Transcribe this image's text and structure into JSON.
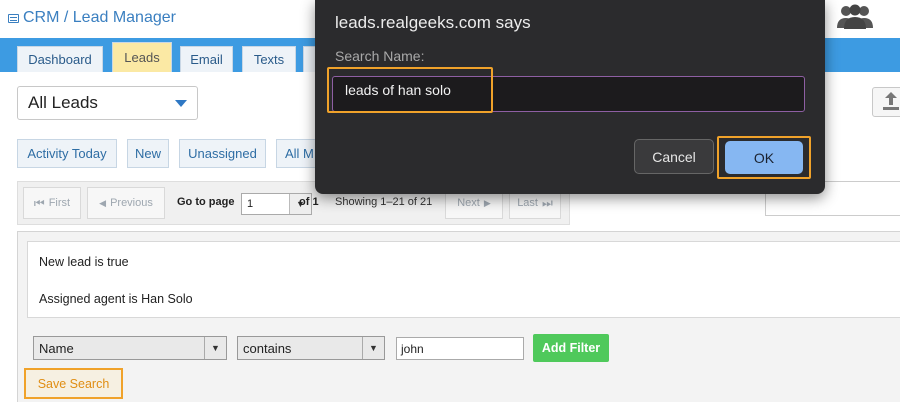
{
  "app": {
    "title": "CRM / Lead Manager",
    "icon": "crm-icon"
  },
  "tabs": [
    {
      "label": "Dashboard",
      "active": false
    },
    {
      "label": "Leads",
      "active": true
    },
    {
      "label": "Email",
      "active": false
    },
    {
      "label": "Texts",
      "active": false
    }
  ],
  "lead_view": {
    "selected": "All Leads"
  },
  "quick_filters": [
    "Activity Today",
    "New",
    "Unassigned",
    "All M"
  ],
  "pager": {
    "first": "First",
    "previous": "Previous",
    "goto_label": "Go to page",
    "page_value": "1",
    "of_label": "of 1",
    "showing": "Showing 1–21 of 21",
    "next": "Next",
    "last": "Last"
  },
  "criteria": [
    "New lead is true",
    "Assigned agent is Han Solo"
  ],
  "filter_builder": {
    "field": "Name",
    "operator": "contains",
    "value": "john",
    "add_label": "Add Filter",
    "save_label": "Save Search"
  },
  "dialog": {
    "title": "leads.realgeeks.com says",
    "prompt": "Search Name:",
    "input_value": "leads of han solo",
    "cancel_label": "Cancel",
    "ok_label": "OK"
  },
  "colors": {
    "tabbar": "#3d9be2",
    "active_tab": "#fbe9a4",
    "highlight": "#f0a22a",
    "add_filter": "#4fc95b",
    "dialog_bg": "#2b2b2d",
    "ok_button": "#86b7f2"
  }
}
